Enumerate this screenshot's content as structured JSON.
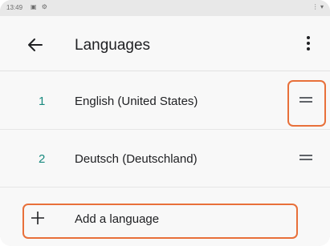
{
  "status_bar": {
    "time": "13:49",
    "notification_icons": "▣ ⚙",
    "system_icons": "⋮ ▾"
  },
  "app_bar": {
    "back_icon": "back-arrow-icon",
    "title": "Languages",
    "more_icon": "more-vert-icon"
  },
  "languages": [
    {
      "index": "1",
      "name": "English (United States)"
    },
    {
      "index": "2",
      "name": "Deutsch (Deutschland)"
    }
  ],
  "add_language": {
    "icon": "plus-icon",
    "label": "Add a language"
  },
  "colors": {
    "accent": "#17897e",
    "highlight": "#e8703a"
  }
}
